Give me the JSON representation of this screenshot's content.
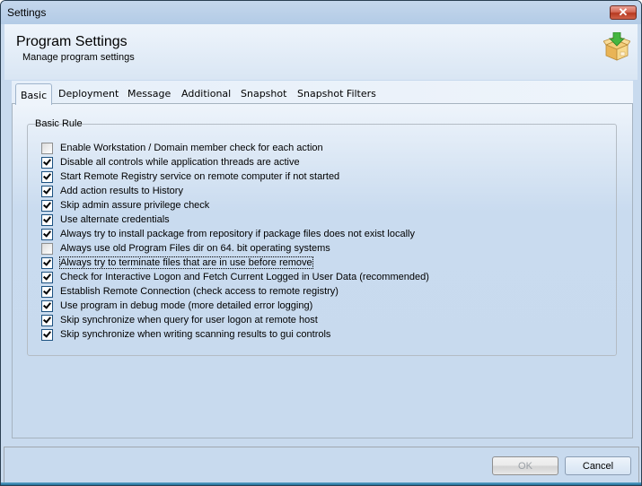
{
  "window": {
    "title": "Settings",
    "close_label": "✕"
  },
  "header": {
    "title": "Program Settings",
    "subtitle": "Manage program settings",
    "icon": "package-download-icon"
  },
  "tabs": [
    {
      "label": "Basic",
      "active": true
    },
    {
      "label": "Deployment",
      "active": false
    },
    {
      "label": "Message",
      "active": false
    },
    {
      "label": "Additional",
      "active": false
    },
    {
      "label": "Snapshot",
      "active": false
    },
    {
      "label": "Snapshot Filters",
      "active": false
    }
  ],
  "group": {
    "label": "Basic Rule",
    "options": [
      {
        "label": "Enable Workstation / Domain member check for each action",
        "checked": false
      },
      {
        "label": "Disable all controls while application threads are active",
        "checked": true
      },
      {
        "label": "Start Remote Registry service on remote computer if not started",
        "checked": true
      },
      {
        "label": "Add action results to History",
        "checked": true
      },
      {
        "label": "Skip admin assure privilege check",
        "checked": true
      },
      {
        "label": "Use alternate credentials",
        "checked": true
      },
      {
        "label": "Always try to install package from repository if package files does not exist locally",
        "checked": true
      },
      {
        "label": "Always use old Program Files dir on 64. bit operating systems",
        "checked": false
      },
      {
        "label": "Always try to terminate files that are in use before remove",
        "checked": true,
        "focused": true
      },
      {
        "label": "Check for Interactive Logon and Fetch Current Logged in User Data (recommended)",
        "checked": true
      },
      {
        "label": "Establish Remote Connection (check access to remote registry)",
        "checked": true
      },
      {
        "label": "Use program in debug mode (more detailed error logging)",
        "checked": true
      },
      {
        "label": "Skip synchronize when query for user logon at remote host",
        "checked": true
      },
      {
        "label": "Skip synchronize when writing scanning results to gui controls",
        "checked": true
      }
    ]
  },
  "buttons": {
    "ok": {
      "label": "OK",
      "enabled": false
    },
    "cancel": {
      "label": "Cancel",
      "enabled": true
    }
  }
}
